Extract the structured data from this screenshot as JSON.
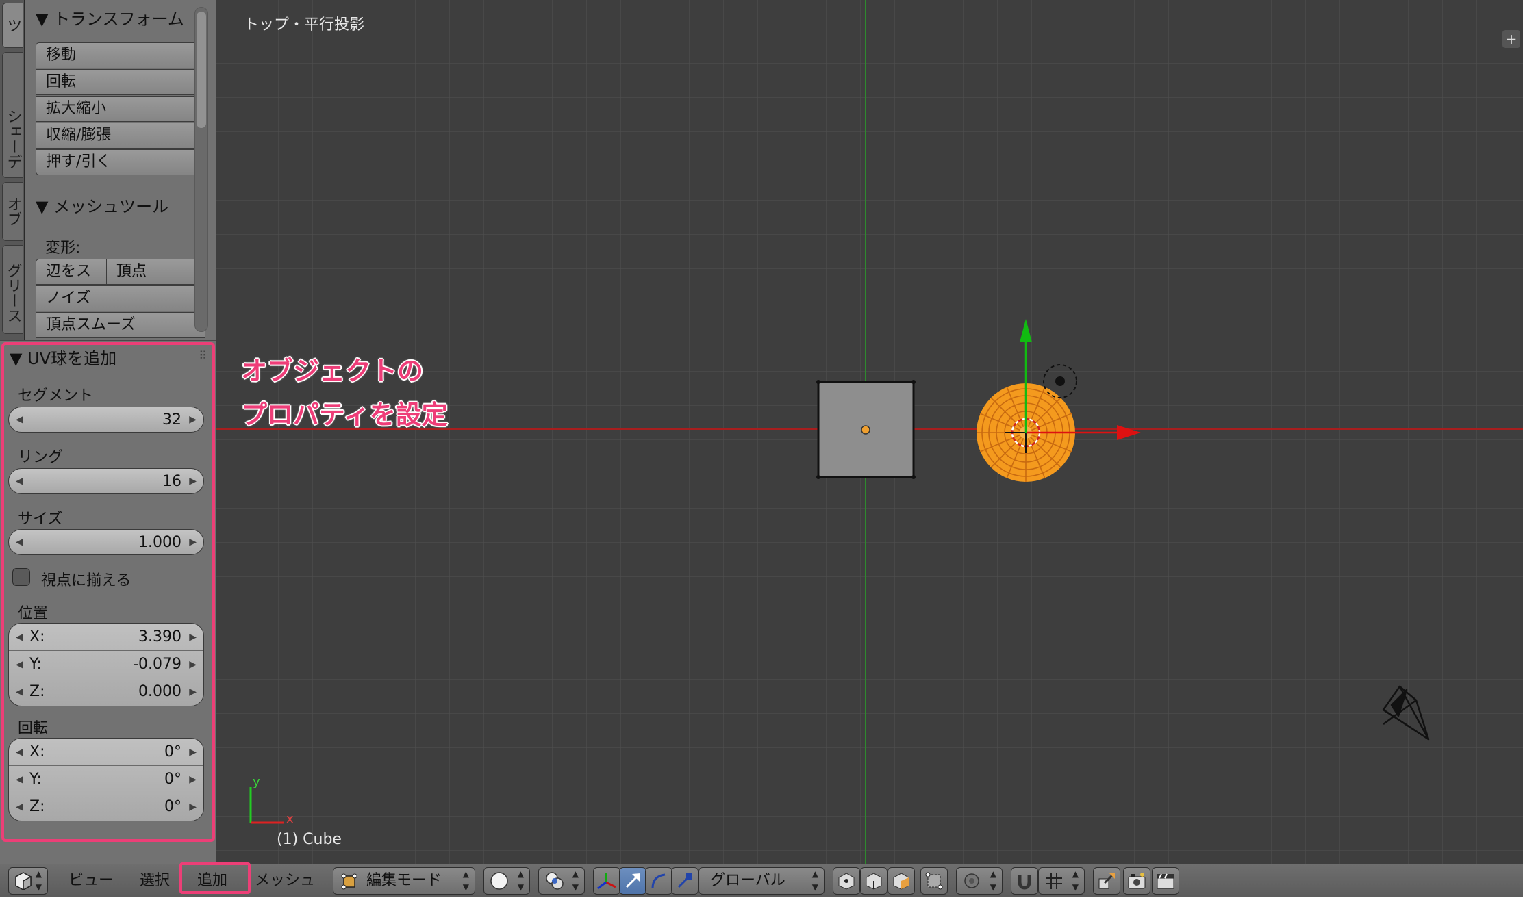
{
  "colors": {
    "accent_highlight": "#ec3f77",
    "selection_orange": "#f49a1e",
    "x_axis": "#cc2222",
    "y_axis": "#22aa22"
  },
  "tabs": [
    {
      "label": "ツ",
      "icon": ""
    },
    {
      "label": "シェーデ",
      "icon": ""
    },
    {
      "label": "オブ",
      "icon": ""
    },
    {
      "label": "グリース",
      "icon": ""
    }
  ],
  "toolshelf": {
    "transform": {
      "title": "▼ トランスフォーム",
      "buttons": [
        "移動",
        "回転",
        "拡大縮小",
        "収縮/膨張",
        "押す/引く"
      ]
    },
    "mesh_tools": {
      "title": "▼ メッシュツール",
      "deform_label": "変形:",
      "row_buttons": [
        "辺をス",
        "頂点"
      ],
      "buttons": [
        "ノイズ",
        "頂点スムーズ"
      ]
    }
  },
  "operator": {
    "title": "▼ UV球を追加",
    "segments": {
      "label": "セグメント",
      "value": "32"
    },
    "rings": {
      "label": "リング",
      "value": "16"
    },
    "size": {
      "label": "サイズ",
      "value": "1.000"
    },
    "align_to_view": {
      "label": "視点に揃える",
      "checked": false
    },
    "location": {
      "label": "位置",
      "x_label": "X:",
      "x": "3.390",
      "y_label": "Y:",
      "y": "-0.079",
      "z_label": "Z:",
      "z": "0.000"
    },
    "rotation": {
      "label": "回転",
      "x_label": "X:",
      "x": "0°",
      "y_label": "Y:",
      "y": "0°",
      "z_label": "Z:",
      "z": "0°"
    }
  },
  "viewport": {
    "title": "トップ・平行投影",
    "status": "(1) Cube",
    "annotation_line1": "オブジェクトの",
    "annotation_line2": "プロパティを設定",
    "axis_x": "x",
    "axis_y": "y",
    "plus": "+"
  },
  "header": {
    "menus": [
      "ビュー",
      "選択",
      "追加",
      "メッシュ"
    ],
    "mode": "編集モード",
    "orientation": "グローバル"
  }
}
